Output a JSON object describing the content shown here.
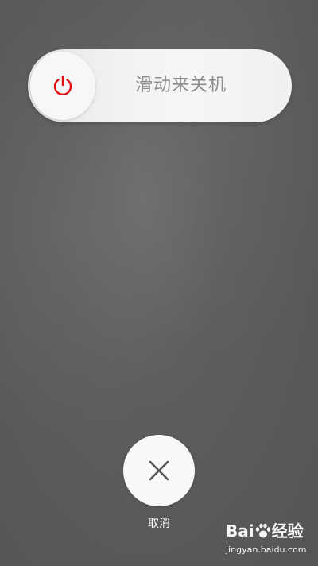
{
  "slider": {
    "label": "滑动来关机",
    "icon": "power-icon",
    "icon_color": "#e01010"
  },
  "cancel": {
    "label": "取消",
    "icon": "close-icon"
  },
  "watermark": {
    "logo_text": "Bai",
    "logo_suffix": "经验",
    "url": "jingyan.baidu.com"
  }
}
